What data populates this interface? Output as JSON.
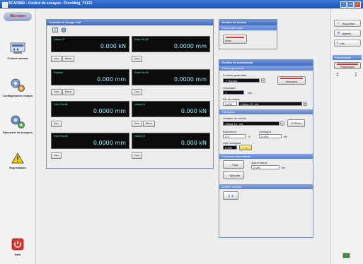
{
  "window": {
    "title": "SCA/3000 - Control de ensayos - Providing_T3132"
  },
  "sidebar": {
    "logo": "Microtest",
    "items": [
      {
        "label": "Control manual"
      },
      {
        "label": "Configuración ensayo"
      },
      {
        "label": "Ejecución de ensayos"
      },
      {
        "label": "Seguridades"
      },
      {
        "label": "Salir"
      }
    ]
  },
  "lecturas": {
    "title": "Lecturas en tiempo real",
    "displays": [
      {
        "channel": "Célula 10",
        "value": "0.000",
        "unit": "kN",
        "btn1": "Cero",
        "btn2": "Memo"
      },
      {
        "channel": "Ext/lc Pto 60",
        "value": "0.0000",
        "unit": "mm",
        "btn1": "Cero",
        "btn2": ""
      },
      {
        "channel": "Posición",
        "value": "0.000",
        "unit": "mm",
        "btn1": "Cero",
        "btn2": "Memo"
      },
      {
        "channel": "Ext/lc Pto 60",
        "value": "0.0000",
        "unit": "mm",
        "btn1": "Cero",
        "btn2": ""
      },
      {
        "channel": "Ext/lc Pto 60",
        "value": "0.0000",
        "unit": "mm",
        "btn1": "Cero",
        "btn2": ""
      },
      {
        "channel": "Célula 10",
        "value": "0.000",
        "unit": "kN",
        "btn1": "Cero",
        "btn2": "Memo"
      },
      {
        "channel": "Ext/lc Pto 60",
        "value": "0.0000",
        "unit": "mm",
        "btn1": "Cero",
        "btn2": ""
      },
      {
        "channel": "Célula 10",
        "value": "0.000",
        "unit": "kN",
        "btn1": "Cero",
        "btn2": ""
      }
    ]
  },
  "bomba": {
    "title": "Gestión de bomba",
    "sub": "Control del motor",
    "btn": "Motor"
  },
  "movimiento": {
    "title": "Gestión de movimiento",
    "gen_section": "Control generador",
    "func_label": "Función generador",
    "func_value": "Rampa",
    "generador_btn": "Generador",
    "vel_label": "Velocidad",
    "vel_value": "1",
    "vel_unit": "N/s",
    "fin_label": "Fin de rampa",
    "fin_value": "0.000",
    "fin_select": "Célula 10 - kN",
    "consigna_section": "Consignas",
    "var_label": "Variable de control",
    "var_value": "Célula 10 - kN",
    "reset_btn": "Reset",
    "esal_label": "Esal servo",
    "esal_value": "0.0",
    "esal_unit": "V",
    "consigna_label": "Consigna",
    "consigna_value": "0.000",
    "consigna_unit": "kN",
    "fija_label": "Fijar consigna",
    "fija_value": "0.000",
    "auto_section": "Funciones automáticas",
    "valor_label": "Valor retorno",
    "valor_value": "0.000",
    "valor_unit": "kN",
    "fijar_btn": "Fijar",
    "ejecutar_btn": "Ejecutar",
    "manual_section": "Gestión manual"
  },
  "rightbar": {
    "buttons": [
      {
        "label": "Seguridad"
      },
      {
        "label": "Ajustes"
      },
      {
        "label": "Info"
      }
    ],
    "section": "Posicionador",
    "pos_btn": "Posicionador"
  },
  "colors": {
    "header_blue": "#3f67bd",
    "display_bg": "#0c0c0c",
    "display_text": "#99eeff",
    "motor_red": "#d33333"
  }
}
